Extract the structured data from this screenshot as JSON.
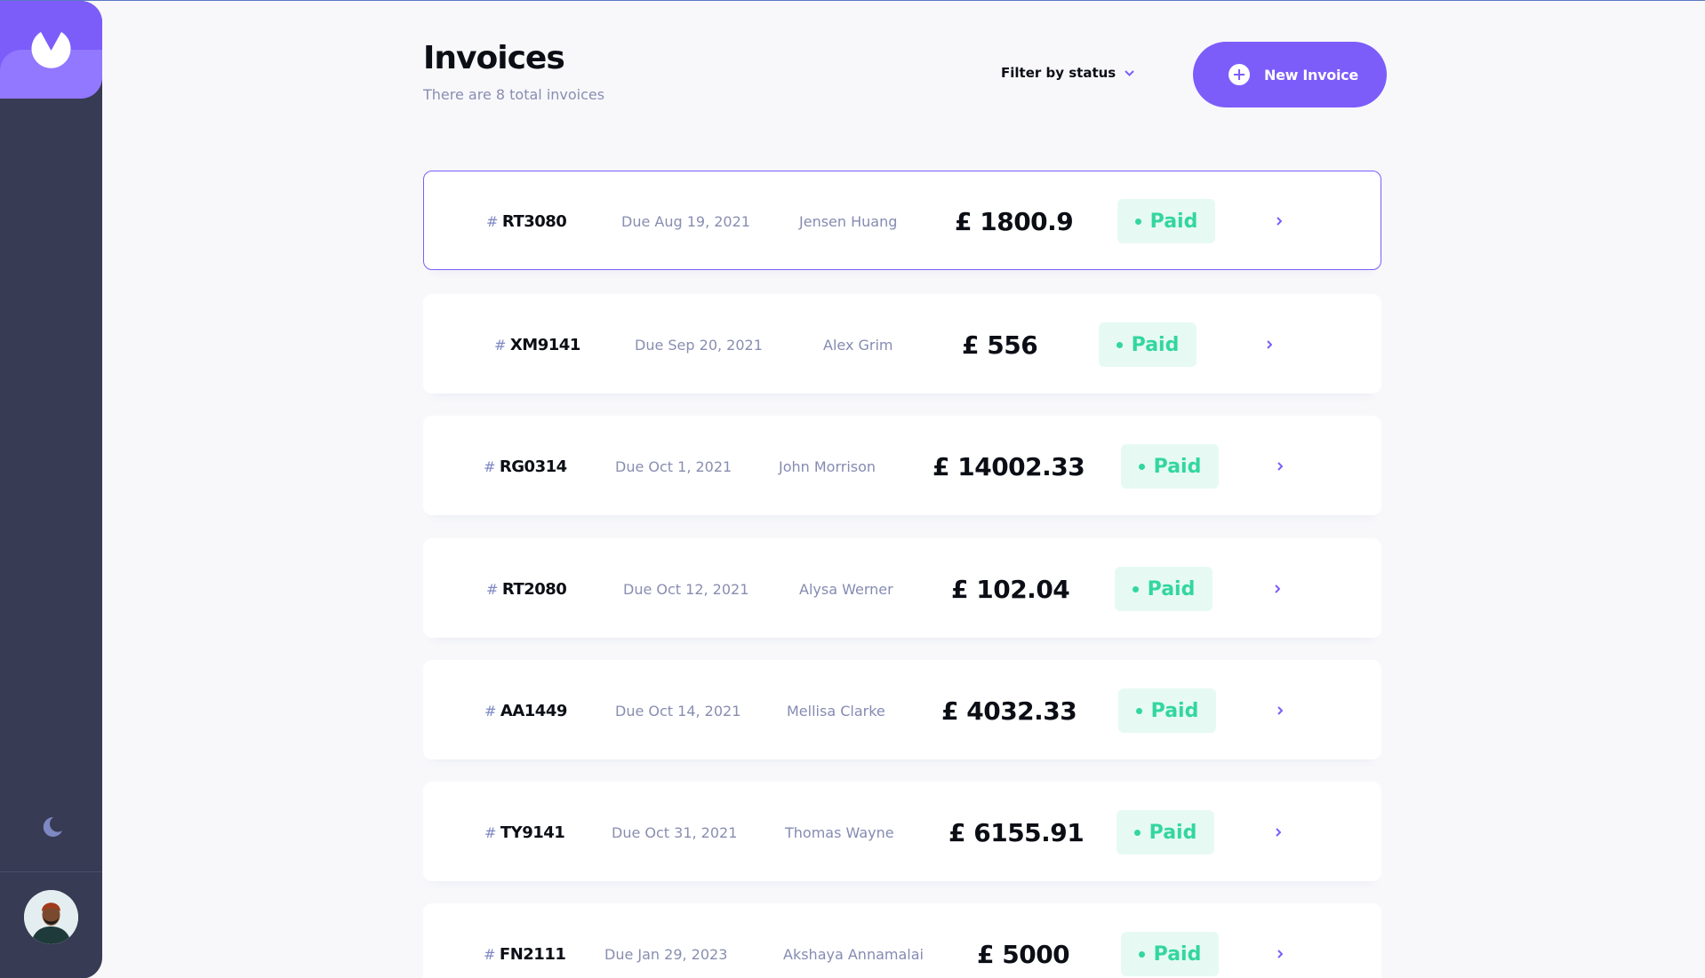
{
  "header": {
    "title": "Invoices",
    "subtitle": "There are 8 total invoices",
    "filter_label": "Filter by status",
    "new_invoice_label": "New Invoice"
  },
  "colors": {
    "accent": "#7c5dfa",
    "sidebar": "#373b53",
    "paid": "#33d69f"
  },
  "invoices": [
    {
      "hash": "#",
      "id": "RT3080",
      "due": "Due Aug 19, 2021",
      "client": "Jensen Huang",
      "amount": "£ 1800.9",
      "status": "Paid",
      "selected": true
    },
    {
      "hash": "#",
      "id": "XM9141",
      "due": "Due Sep 20, 2021",
      "client": "Alex Grim",
      "amount": "£ 556",
      "status": "Paid"
    },
    {
      "hash": "#",
      "id": "RG0314",
      "due": "Due Oct 1, 2021",
      "client": "John Morrison",
      "amount": "£ 14002.33",
      "status": "Paid"
    },
    {
      "hash": "#",
      "id": "RT2080",
      "due": "Due Oct 12, 2021",
      "client": "Alysa Werner",
      "amount": "£ 102.04",
      "status": "Paid"
    },
    {
      "hash": "#",
      "id": "AA1449",
      "due": "Due Oct 14, 2021",
      "client": "Mellisa Clarke",
      "amount": "£ 4032.33",
      "status": "Paid"
    },
    {
      "hash": "#",
      "id": "TY9141",
      "due": "Due Oct 31, 2021",
      "client": "Thomas Wayne",
      "amount": "£ 6155.91",
      "status": "Paid"
    },
    {
      "hash": "#",
      "id": "FN2111",
      "due": "Due Jan 29, 2023",
      "client": "Akshaya Annamalai",
      "amount": "£ 5000",
      "status": "Paid"
    }
  ],
  "icons": {
    "logo": "app-logo-icon",
    "theme": "moon-icon",
    "filter": "chevron-down-icon",
    "new": "plus-circle-icon",
    "row": "chevron-right-icon"
  }
}
